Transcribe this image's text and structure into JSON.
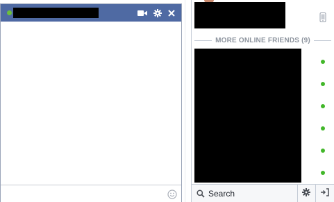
{
  "chat_window": {
    "contact_name": "",
    "status": "online",
    "icons": [
      "video-call-icon",
      "settings-gear-icon",
      "close-icon"
    ],
    "input_placeholder": "",
    "emoji_icon": "smiley-icon"
  },
  "buddy_list": {
    "section_header": "MORE ONLINE FRIENDS (9)",
    "online_status_color": "#42b72a",
    "footer": {
      "search_label": "Search",
      "icons": [
        "search-icon",
        "settings-gear-icon",
        "popout-icon"
      ]
    }
  },
  "colors": {
    "header_bg": "#4f6aa3",
    "online_green": "#6dbf3b"
  }
}
